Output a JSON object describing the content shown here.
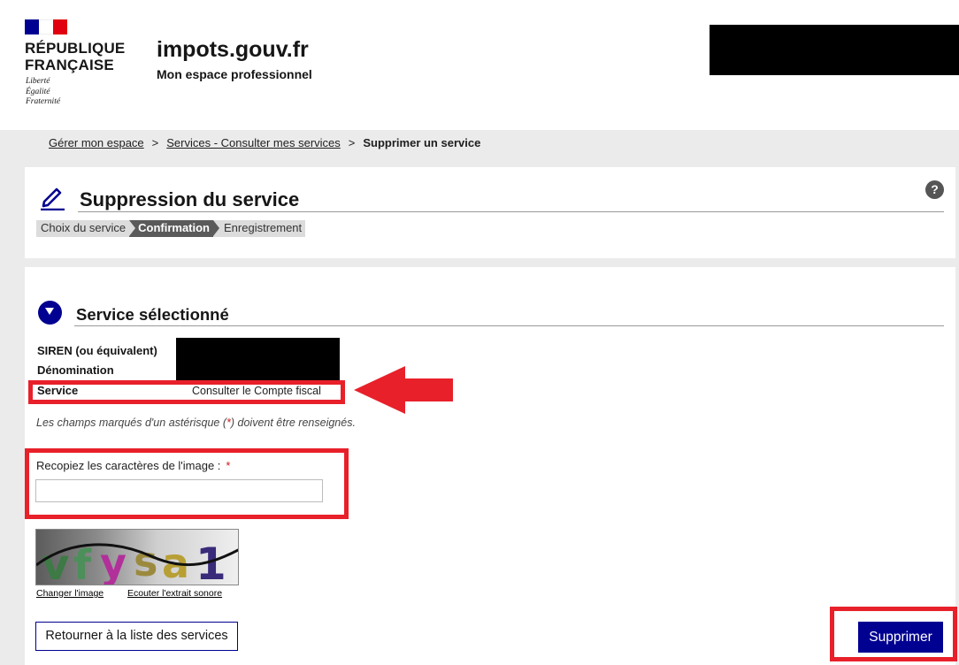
{
  "header": {
    "republic_line1": "RÉPUBLIQUE",
    "republic_line2": "FRANÇAISE",
    "motto_1": "Liberté",
    "motto_2": "Égalité",
    "motto_3": "Fraternité",
    "site_title": "impots.gouv.fr",
    "site_subtitle": "Mon espace professionnel",
    "flag_colors": [
      "#000091",
      "#ffffff",
      "#e1000f"
    ]
  },
  "breadcrumb": {
    "item1": "Gérer mon espace",
    "item2": "Services - Consulter mes services",
    "current": "Supprimer un service",
    "separator": ">"
  },
  "page": {
    "title": "Suppression du service",
    "help": "?",
    "steps": [
      "Choix du service",
      "Confirmation",
      "Enregistrement"
    ],
    "active_step": "Confirmation"
  },
  "section": {
    "title": "Service sélectionné",
    "fields": {
      "siren_label": "SIREN (ou équivalent)",
      "denomination_label": "Dénomination",
      "service_label": "Service",
      "service_value": "Consulter le Compte fiscal"
    },
    "asterisk_note_before": "Les champs marqués d'un astérisque (",
    "asterisk_star": "*",
    "asterisk_note_after": ") doivent être renseignés."
  },
  "captcha": {
    "label": "Recopiez les caractères de l'image :",
    "required": "*",
    "input_value": "",
    "image_chars": [
      "v",
      "f",
      "y",
      "s",
      "a",
      "1"
    ],
    "image_char_colors": [
      "#3d7a45",
      "#4c8f5a",
      "#b1309a",
      "#9b8a3e",
      "#b89f34",
      "#3a2a7a"
    ],
    "change_link": "Changer l'image",
    "audio_link": "Ecouter l'extrait sonore"
  },
  "actions": {
    "back_label": "Retourner à la liste des services",
    "delete_label": "Supprimer"
  },
  "colors": {
    "accent": "#000091",
    "highlight": "#e8202a"
  }
}
